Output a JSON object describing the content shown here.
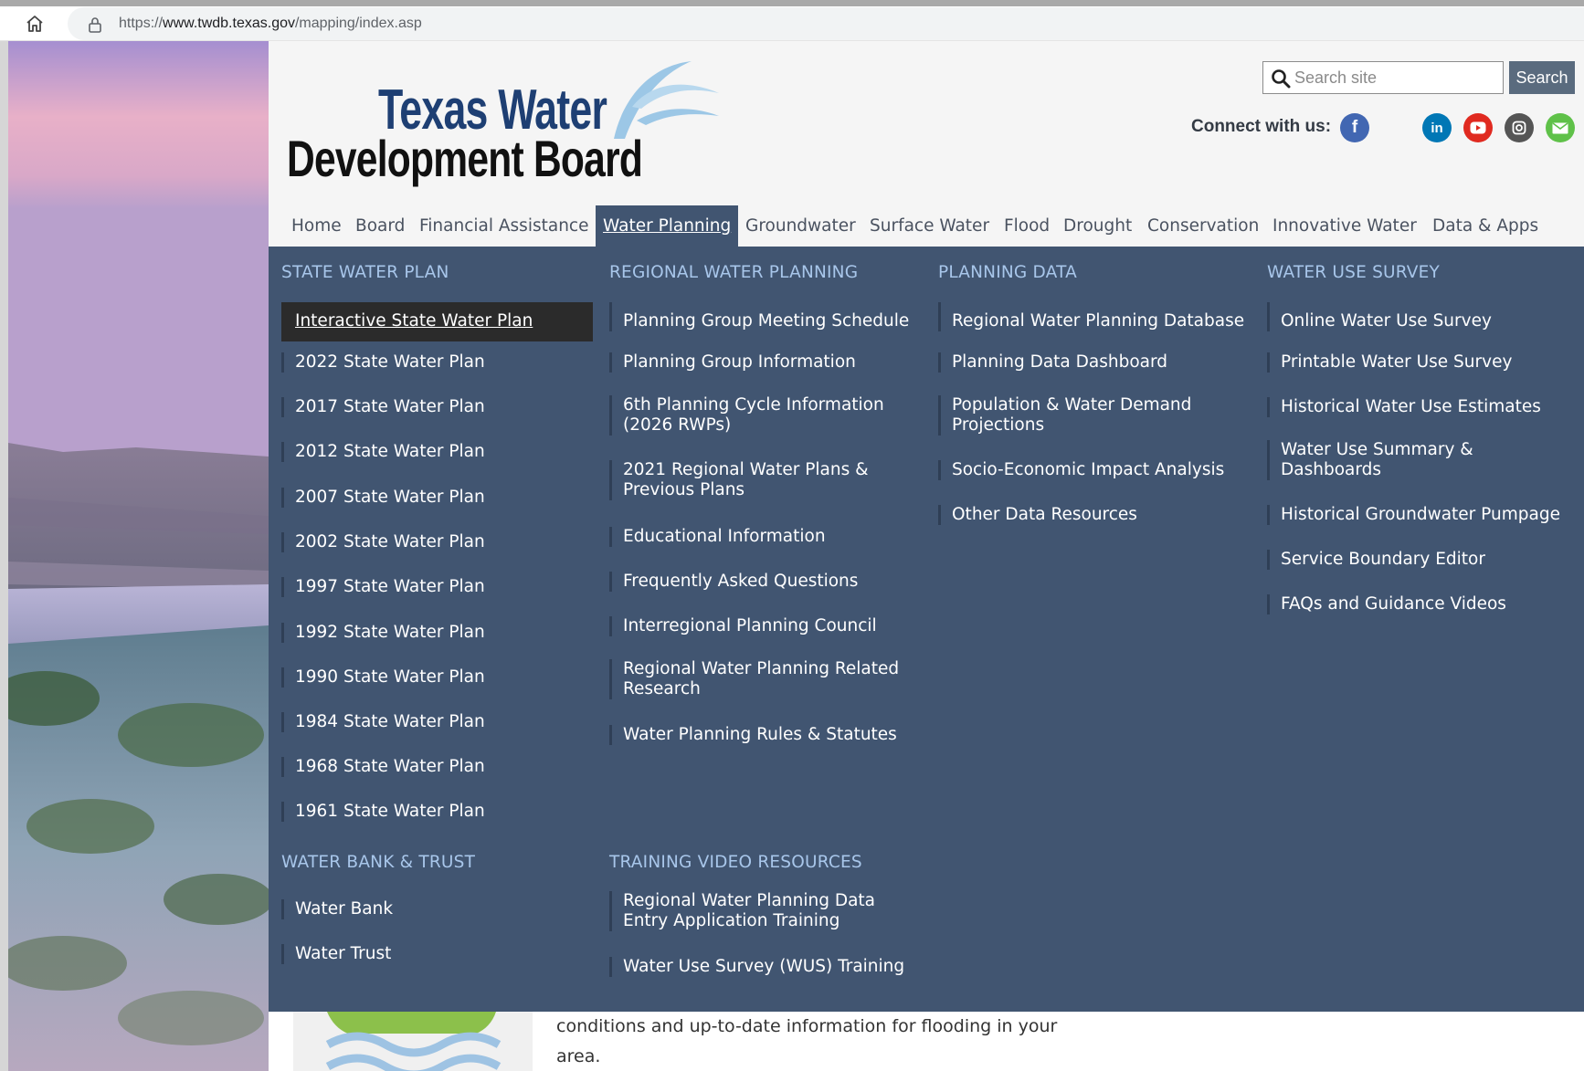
{
  "browser": {
    "url_prefix": "https://",
    "url_domain": "www.twdb.texas.gov",
    "url_path": "/mapping/index.asp"
  },
  "header": {
    "logo_line1": "Texas Water",
    "logo_line2": "Development Board",
    "search_placeholder": "Search site",
    "search_button": "Search",
    "connect_label": "Connect with us:",
    "social": [
      "facebook",
      "linkedin",
      "youtube",
      "instagram",
      "email"
    ]
  },
  "nav": {
    "items": [
      "Home",
      "Board",
      "Financial Assistance",
      "Water Planning",
      "Groundwater",
      "Surface Water",
      "Flood",
      "Drought",
      "Conservation",
      "Innovative Water",
      "Data & Apps"
    ],
    "active": "Water Planning"
  },
  "menu": {
    "state_water_plan": {
      "title": "STATE WATER PLAN",
      "links": [
        "Interactive State Water Plan",
        "2022 State Water Plan",
        "2017 State Water Plan",
        "2012 State Water Plan",
        "2007 State Water Plan",
        "2002 State Water Plan",
        "1997 State Water Plan",
        "1992 State Water Plan",
        "1990 State Water Plan",
        "1984 State Water Plan",
        "1968 State Water Plan",
        "1961 State Water Plan"
      ]
    },
    "regional": {
      "title": "REGIONAL WATER PLANNING",
      "links": [
        [
          "Planning Group Meeting Schedule"
        ],
        [
          "Planning Group Information"
        ],
        [
          "6th Planning Cycle Information",
          "(2026 RWPs)"
        ],
        [
          "2021 Regional Water Plans &",
          "Previous Plans"
        ],
        [
          "Educational Information"
        ],
        [
          "Frequently Asked Questions"
        ],
        [
          "Interregional Planning Council"
        ],
        [
          "Regional Water Planning Related",
          "Research"
        ],
        [
          "Water Planning Rules & Statutes"
        ]
      ]
    },
    "planning_data": {
      "title": "PLANNING DATA",
      "links": [
        [
          "Regional Water Planning Database"
        ],
        [
          "Planning Data Dashboard"
        ],
        [
          "Population & Water Demand",
          "Projections"
        ],
        [
          "Socio-Economic Impact Analysis"
        ],
        [
          "Other Data Resources"
        ]
      ]
    },
    "water_use": {
      "title": "WATER USE SURVEY",
      "links": [
        [
          "Online Water Use Survey"
        ],
        [
          "Printable Water Use Survey"
        ],
        [
          "Historical Water Use Estimates"
        ],
        [
          "Water Use Summary &",
          "Dashboards"
        ],
        [
          "Historical Groundwater Pumpage"
        ],
        [
          "Service Boundary Editor"
        ],
        [
          "FAQs and Guidance Videos"
        ]
      ]
    },
    "water_bank": {
      "title": "WATER BANK & TRUST",
      "links": [
        "Water Bank",
        "Water Trust"
      ]
    },
    "training": {
      "title": "TRAINING VIDEO RESOURCES",
      "links": [
        [
          "Regional Water Planning Data",
          "Entry Application Training"
        ],
        [
          "Water Use Survey (WUS) Training"
        ]
      ]
    }
  },
  "content": {
    "flood_line1": "conditions and up-to-date information for flooding in your",
    "flood_line2": "area."
  },
  "colors": {
    "menu_bg": "#415571",
    "section_title": "#a8c6ea",
    "logo_blue": "#1e3f73"
  }
}
